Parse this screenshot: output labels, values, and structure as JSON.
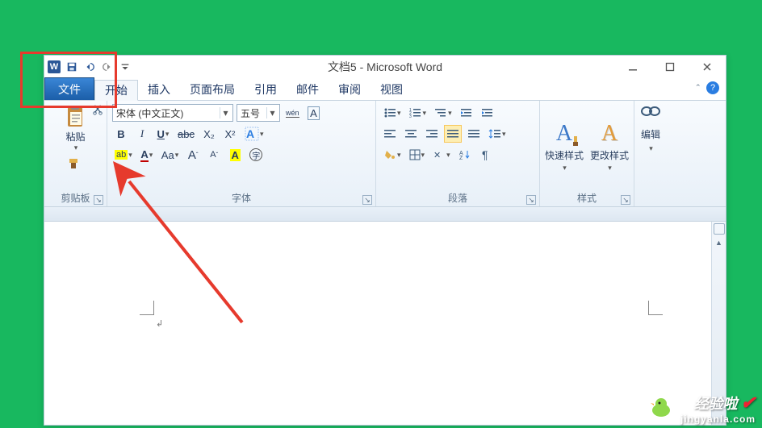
{
  "title": "文档5 - Microsoft Word",
  "quick_access": {
    "word_logo": "W",
    "save": "save",
    "undo": "undo",
    "redo": "redo"
  },
  "tabs": {
    "file": "文件",
    "home": "开始",
    "insert": "插入",
    "layout": "页面布局",
    "references": "引用",
    "mail": "邮件",
    "review": "审阅",
    "view": "视图"
  },
  "groups": {
    "clipboard": {
      "label": "剪贴板",
      "paste": "粘贴"
    },
    "font": {
      "label": "字体",
      "font_name": "宋体 (中文正文)",
      "font_size": "五号",
      "wen": "wén",
      "a_box": "A",
      "bold": "B",
      "italic": "I",
      "underline": "U",
      "strike": "abc",
      "sub": "X₂",
      "sup": "X²",
      "phonetic": "A",
      "char_border": "A",
      "highlight": "ab",
      "font_scale": "Aa",
      "grow": "A",
      "shrink": "A",
      "a_highlight": "A",
      "circled": "字"
    },
    "paragraph": {
      "label": "段落"
    },
    "styles": {
      "label": "样式",
      "quick": "快速样式",
      "change": "更改样式"
    },
    "editing": {
      "label": "编辑"
    }
  },
  "watermark": {
    "line1": "经验啦",
    "line2": "jingyanla.com"
  }
}
